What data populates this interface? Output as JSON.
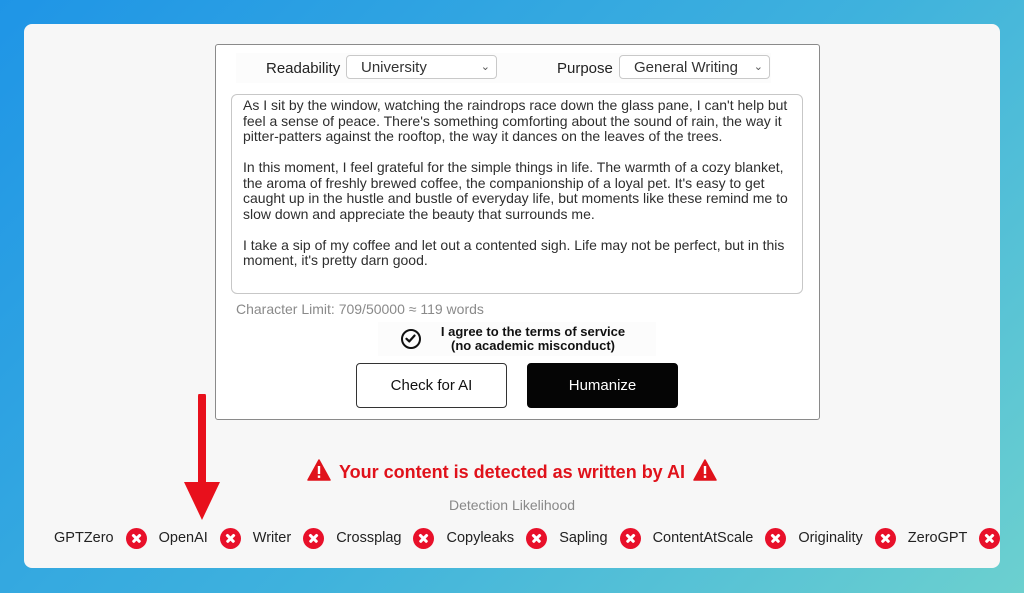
{
  "form": {
    "readability_label": "Readability",
    "readability_value": "University",
    "purpose_label": "Purpose",
    "purpose_value": "General Writing",
    "text_paragraphs": [
      "As I sit by the window, watching the raindrops race down the glass pane, I can't help but feel a sense of peace. There's something comforting about the sound of rain, the way it pitter-patters against the rooftop, the way it dances on the leaves of the trees.",
      "In this moment, I feel grateful for the simple things in life. The warmth of a cozy blanket, the aroma of freshly brewed coffee, the companionship of a loyal pet. It's easy to get caught up in the hustle and bustle of everyday life, but moments like these remind me to slow down and appreciate the beauty that surrounds me.",
      "I take a sip of my coffee and let out a contented sigh. Life may not be perfect, but in this moment, it's pretty darn good."
    ],
    "char_limit": "Character Limit: 709/50000 ≈ 119 words",
    "agree_line1": "I agree to the terms of service",
    "agree_line2": "(no academic misconduct)",
    "check_button": "Check for AI",
    "humanize_button": "Humanize"
  },
  "result": {
    "alert": "Your content is detected as written by AI",
    "likelihood_label": "Detection Likelihood",
    "detectors": [
      {
        "name": "GPTZero",
        "status": "fail"
      },
      {
        "name": "OpenAI",
        "status": "fail"
      },
      {
        "name": "Writer",
        "status": "fail"
      },
      {
        "name": "Crossplag",
        "status": "fail"
      },
      {
        "name": "Copyleaks",
        "status": "fail"
      },
      {
        "name": "Sapling",
        "status": "fail"
      },
      {
        "name": "ContentAtScale",
        "status": "fail"
      },
      {
        "name": "Originality",
        "status": "fail"
      },
      {
        "name": "ZeroGPT",
        "status": "fail"
      }
    ]
  },
  "colors": {
    "alert": "#e0121b",
    "fail_badge": "#e8102a",
    "annotation_arrow": "#e8101c"
  }
}
